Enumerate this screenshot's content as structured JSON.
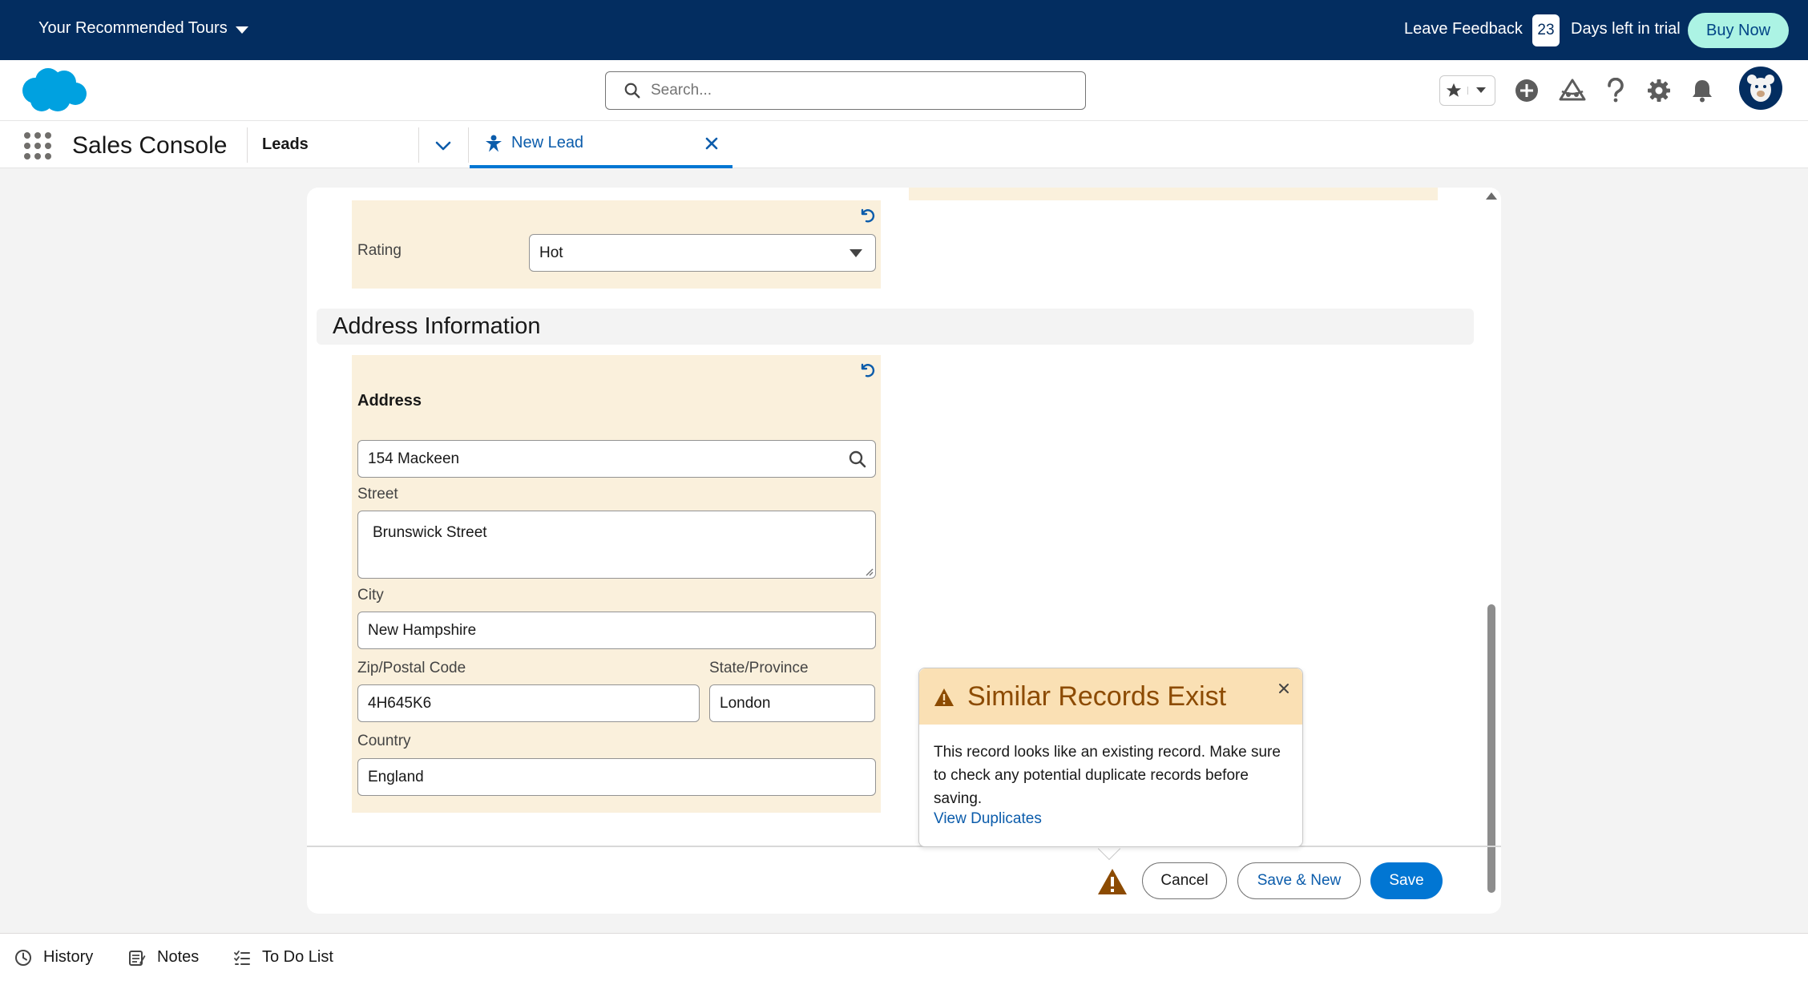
{
  "banner": {
    "tours_label": "Your Recommended Tours",
    "feedback_label": "Leave Feedback",
    "days_count": "23",
    "days_text": "Days left in trial",
    "buy_label": "Buy Now"
  },
  "header": {
    "search_placeholder": "Search...",
    "icons": [
      "favorites-star-icon",
      "favorites-dropdown-icon",
      "global-add-icon",
      "trailhead-icon",
      "help-icon",
      "setup-gear-icon",
      "notifications-bell-icon",
      "user-avatar"
    ]
  },
  "appnav": {
    "app_name": "Sales Console",
    "object_tab": "Leads",
    "active_tab": "New Lead"
  },
  "form": {
    "rating": {
      "label": "Rating",
      "value": "Hot"
    },
    "section_title": "Address Information",
    "address": {
      "label": "Address",
      "search_value": "154 Mackeen",
      "street_label": "Street",
      "street_value": "Brunswick Street",
      "city_label": "City",
      "city_value": "New Hampshire",
      "zip_label": "Zip/Postal Code",
      "zip_value": "4H645K6",
      "state_label": "State/Province",
      "state_value": "London",
      "country_label": "Country",
      "country_value": "England"
    }
  },
  "footer": {
    "cancel_label": "Cancel",
    "save_new_label": "Save & New",
    "save_label": "Save"
  },
  "popover": {
    "title": "Similar Records Exist",
    "body": "This record looks like an existing record. Make sure to check any potential duplicate records before saving.",
    "link": "View Duplicates"
  },
  "utility_bar": {
    "history": "History",
    "notes": "Notes",
    "todo": "To Do List"
  },
  "colors": {
    "banner_bg": "#032d60",
    "brand_blue": "#0176d3",
    "highlight": "#faf0dc",
    "warning_header": "#fae0b4",
    "warning_text": "#8c4b02"
  }
}
